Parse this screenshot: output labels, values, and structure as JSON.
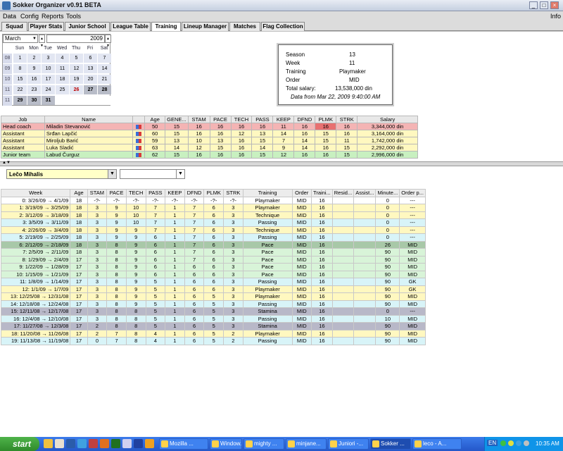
{
  "window": {
    "title": "Sokker Organizer v0.91 BETA",
    "min": "_",
    "max": "□",
    "close": "×"
  },
  "menu": {
    "items": [
      "Data",
      "Config",
      "Reports",
      "Tools"
    ],
    "info": "Info"
  },
  "tabs": [
    "Squad",
    "Player Stats",
    "Junior School",
    "League Table",
    "Training",
    "Lineup Manager",
    "Matches",
    "Flag Collection"
  ],
  "active_tab": "Training",
  "calendar": {
    "month": "March",
    "year": "2009",
    "dow": [
      "Sun",
      "Mon",
      "Tue",
      "Wed",
      "Thu",
      "Fri",
      "Sat"
    ],
    "weeks": [
      {
        "wk": "08",
        "days": [
          "1",
          "2",
          "3",
          "4",
          "5",
          "6",
          "7"
        ]
      },
      {
        "wk": "09",
        "days": [
          "8",
          "9",
          "10",
          "11",
          "12",
          "13",
          "14"
        ]
      },
      {
        "wk": "10",
        "days": [
          "15",
          "16",
          "17",
          "18",
          "19",
          "20",
          "21"
        ]
      },
      {
        "wk": "11",
        "days": [
          "22",
          "23",
          "24",
          "25",
          "26",
          "27",
          "28"
        ]
      },
      {
        "wk": "11",
        "days": [
          "29",
          "30",
          "31",
          "",
          "",
          "",
          ""
        ]
      }
    ],
    "selected": "26"
  },
  "info": {
    "rows": [
      {
        "label": "Season",
        "value": "13"
      },
      {
        "label": "Week",
        "value": "11"
      },
      {
        "label": "Training",
        "value": "Playmaker"
      },
      {
        "label": "Order",
        "value": "MID"
      },
      {
        "label": "Total salary:",
        "value": "13,538,000 din"
      }
    ],
    "data_from": "Data from Mar 22, 2009 9:40:00 AM"
  },
  "staff": {
    "headers": [
      "Job",
      "Name",
      "",
      "Age",
      "GENE...",
      "STAM",
      "PACE",
      "TECH",
      "PASS",
      "KEEP",
      "DFND",
      "PLMK",
      "STRK",
      "Salary"
    ],
    "rows": [
      {
        "job": "Head coach",
        "name": "Miladin Stevanović",
        "age": "50",
        "gene": "15",
        "stam": "16",
        "pace": "16",
        "tech": "16",
        "pass": "16",
        "keep": "11",
        "dfnd": "16",
        "plmk": "16",
        "strk": "16",
        "salary": "3,344,000 din",
        "color": "#f4b4b4"
      },
      {
        "job": "Assistant",
        "name": "Srđan Lapčić",
        "age": "60",
        "gene": "15",
        "stam": "16",
        "pace": "16",
        "tech": "12",
        "pass": "13",
        "keep": "14",
        "dfnd": "16",
        "plmk": "15",
        "strk": "16",
        "salary": "3,164,000 din",
        "color": "#fff8c0"
      },
      {
        "job": "Assistant",
        "name": "Miroljub Barić",
        "age": "59",
        "gene": "13",
        "stam": "10",
        "tech": "16",
        "pace": "13",
        "pass": "15",
        "keep": "7",
        "dfnd": "14",
        "plmk": "15",
        "strk": "11",
        "salary": "1,742,000 din",
        "color": "#fff8c0"
      },
      {
        "job": "Assistant",
        "name": "Luka Sladić",
        "age": "63",
        "gene": "14",
        "stam": "12",
        "pace": "15",
        "tech": "16",
        "pass": "14",
        "keep": "9",
        "dfnd": "14",
        "plmk": "16",
        "strk": "15",
        "salary": "2,292,000 din",
        "color": "#fff8c0"
      },
      {
        "job": "Junior team",
        "name": "Labud Čurguz",
        "age": "62",
        "gene": "15",
        "stam": "16",
        "pace": "16",
        "tech": "16",
        "pass": "15",
        "keep": "12",
        "dfnd": "16",
        "plmk": "16",
        "strk": "15",
        "salary": "2,996,000 din",
        "color": "#c8f0c0"
      }
    ]
  },
  "player_select": {
    "value": "Lečo Mihalis",
    "second": ""
  },
  "training": {
    "headers": [
      "Week",
      "Age",
      "STAM",
      "PACE",
      "TECH",
      "PASS",
      "KEEP",
      "DFND",
      "PLMK",
      "STRK",
      "Training",
      "Order",
      "Traini...",
      "Resid...",
      "Assist...",
      "Minute...",
      "Order p..."
    ],
    "rows": [
      {
        "week": "0: 3/26/09 → 4/1/09",
        "age": "18",
        "stam": "-?-",
        "pace": "-?-",
        "tech": "-?-",
        "pass": "-?-",
        "keep": "-?-",
        "dfnd": "-?-",
        "plmk": "-?-",
        "strk": "-?-",
        "training": "Playmaker",
        "order": "MID",
        "traini": "16",
        "resid": "",
        "assist": "",
        "minute": "0",
        "orderp": "---",
        "color": "#ffffff"
      },
      {
        "week": "1: 3/19/09 → 3/25/09",
        "age": "18",
        "stam": "3",
        "pace": "9",
        "tech": "10",
        "pass": "7",
        "keep": "1",
        "dfnd": "7",
        "plmk": "6",
        "strk": "3",
        "training": "Playmaker",
        "order": "MID",
        "traini": "16",
        "resid": "",
        "assist": "",
        "minute": "0",
        "orderp": "---",
        "color": "#fff8c0"
      },
      {
        "week": "2: 3/12/09 → 3/18/09",
        "age": "18",
        "stam": "3",
        "pace": "9",
        "tech": "10",
        "pass": "7",
        "keep": "1",
        "dfnd": "7",
        "plmk": "6",
        "strk": "3",
        "training": "Technique",
        "order": "MID",
        "traini": "16",
        "resid": "",
        "assist": "",
        "minute": "0",
        "orderp": "---",
        "color": "#fff8c0"
      },
      {
        "week": "3: 3/5/09 → 3/11/09",
        "age": "18",
        "stam": "3",
        "pace": "9",
        "tech": "10",
        "pass": "7",
        "keep": "1",
        "dfnd": "7",
        "plmk": "6",
        "strk": "3",
        "training": "Passing",
        "order": "MID",
        "traini": "16",
        "resid": "",
        "assist": "",
        "minute": "0",
        "orderp": "---",
        "color": "#d8f4f8"
      },
      {
        "week": "4: 2/26/09 → 3/4/09",
        "age": "18",
        "stam": "3",
        "pace": "9",
        "tech": "9",
        "pass": "7",
        "keep": "1",
        "dfnd": "7",
        "plmk": "6",
        "strk": "3",
        "training": "Technique",
        "order": "MID",
        "traini": "16",
        "resid": "",
        "assist": "",
        "minute": "0",
        "orderp": "---",
        "color": "#fff8c0"
      },
      {
        "week": "5: 2/19/09 → 2/25/09",
        "age": "18",
        "stam": "3",
        "pace": "9",
        "tech": "9",
        "pass": "6",
        "keep": "1",
        "dfnd": "7",
        "plmk": "6",
        "strk": "3",
        "training": "Passing",
        "order": "MID",
        "traini": "16",
        "resid": "",
        "assist": "",
        "minute": "0",
        "orderp": "---",
        "color": "#d8f4f8"
      },
      {
        "week": "6: 2/12/09 → 2/18/09",
        "age": "18",
        "stam": "3",
        "pace": "8",
        "tech": "9",
        "pass": "6",
        "keep": "1",
        "dfnd": "7",
        "plmk": "6",
        "strk": "3",
        "training": "Pace",
        "order": "MID",
        "traini": "16",
        "resid": "",
        "assist": "",
        "minute": "26",
        "orderp": "MID",
        "color": "#a8c8a8"
      },
      {
        "week": "7: 2/5/09 → 2/11/09",
        "age": "18",
        "stam": "3",
        "pace": "8",
        "tech": "9",
        "pass": "6",
        "keep": "1",
        "dfnd": "7",
        "plmk": "6",
        "strk": "3",
        "training": "Pace",
        "order": "MID",
        "traini": "16",
        "resid": "",
        "assist": "",
        "minute": "90",
        "orderp": "MID",
        "color": "#d8f4d8"
      },
      {
        "week": "8: 1/29/09 → 2/4/09",
        "age": "17",
        "stam": "3",
        "pace": "8",
        "tech": "9",
        "pass": "6",
        "keep": "1",
        "dfnd": "7",
        "plmk": "6",
        "strk": "3",
        "training": "Pace",
        "order": "MID",
        "traini": "16",
        "resid": "",
        "assist": "",
        "minute": "90",
        "orderp": "MID",
        "color": "#d8f4d8"
      },
      {
        "week": "9: 1/22/09 → 1/28/09",
        "age": "17",
        "stam": "3",
        "pace": "8",
        "tech": "9",
        "pass": "6",
        "keep": "1",
        "dfnd": "6",
        "plmk": "6",
        "strk": "3",
        "training": "Pace",
        "order": "MID",
        "traini": "16",
        "resid": "",
        "assist": "",
        "minute": "90",
        "orderp": "MID",
        "color": "#d8f4d8"
      },
      {
        "week": "10: 1/15/09 → 1/21/09",
        "age": "17",
        "stam": "3",
        "pace": "8",
        "tech": "9",
        "pass": "6",
        "keep": "1",
        "dfnd": "6",
        "plmk": "6",
        "strk": "3",
        "training": "Pace",
        "order": "MID",
        "traini": "16",
        "resid": "",
        "assist": "",
        "minute": "90",
        "orderp": "MID",
        "color": "#d8f4d8"
      },
      {
        "week": "11: 1/8/09 → 1/14/09",
        "age": "17",
        "stam": "3",
        "pace": "8",
        "tech": "9",
        "pass": "5",
        "keep": "1",
        "dfnd": "6",
        "plmk": "6",
        "strk": "3",
        "training": "Passing",
        "order": "MID",
        "traini": "16",
        "resid": "",
        "assist": "",
        "minute": "90",
        "orderp": "GK",
        "color": "#d8f4f8"
      },
      {
        "week": "12: 1/1/09 → 1/7/09",
        "age": "17",
        "stam": "3",
        "pace": "8",
        "tech": "9",
        "pass": "5",
        "keep": "1",
        "dfnd": "6",
        "plmk": "6",
        "strk": "3",
        "training": "Playmaker",
        "order": "MID",
        "traini": "16",
        "resid": "",
        "assist": "",
        "minute": "90",
        "orderp": "GK",
        "color": "#fff8c0"
      },
      {
        "week": "13: 12/25/08 → 12/31/08",
        "age": "17",
        "stam": "3",
        "pace": "8",
        "tech": "9",
        "pass": "5",
        "keep": "1",
        "dfnd": "6",
        "plmk": "5",
        "strk": "3",
        "training": "Playmaker",
        "order": "MID",
        "traini": "16",
        "resid": "",
        "assist": "",
        "minute": "90",
        "orderp": "MID",
        "color": "#fff8c0"
      },
      {
        "week": "14: 12/18/08 → 12/24/08",
        "age": "17",
        "stam": "3",
        "pace": "8",
        "tech": "9",
        "pass": "5",
        "keep": "1",
        "dfnd": "6",
        "plmk": "5",
        "strk": "3",
        "training": "Passing",
        "order": "MID",
        "traini": "16",
        "resid": "",
        "assist": "",
        "minute": "90",
        "orderp": "MID",
        "color": "#d8f4f8"
      },
      {
        "week": "15: 12/11/08 → 12/17/08",
        "age": "17",
        "stam": "3",
        "pace": "8",
        "tech": "8",
        "pass": "5",
        "keep": "1",
        "dfnd": "6",
        "plmk": "5",
        "strk": "3",
        "training": "Stamina",
        "order": "MID",
        "traini": "16",
        "resid": "",
        "assist": "",
        "minute": "0",
        "orderp": "---",
        "color": "#b8b8c8"
      },
      {
        "week": "16: 12/4/08 → 12/10/08",
        "age": "17",
        "stam": "3",
        "pace": "8",
        "tech": "8",
        "pass": "5",
        "keep": "1",
        "dfnd": "6",
        "plmk": "5",
        "strk": "3",
        "training": "Passing",
        "order": "MID",
        "traini": "16",
        "resid": "",
        "assist": "",
        "minute": "10",
        "orderp": "MID",
        "color": "#d8f4f8"
      },
      {
        "week": "17: 11/27/08 → 12/3/08",
        "age": "17",
        "stam": "2",
        "pace": "8",
        "tech": "8",
        "pass": "5",
        "keep": "1",
        "dfnd": "6",
        "plmk": "5",
        "strk": "3",
        "training": "Stamina",
        "order": "MID",
        "traini": "16",
        "resid": "",
        "assist": "",
        "minute": "90",
        "orderp": "MID",
        "color": "#b8b8c8"
      },
      {
        "week": "18: 11/20/08 → 11/26/08",
        "age": "17",
        "stam": "2",
        "pace": "7",
        "tech": "8",
        "pass": "4",
        "keep": "1",
        "dfnd": "6",
        "plmk": "5",
        "strk": "2",
        "training": "Playmaker",
        "order": "MID",
        "traini": "16",
        "resid": "",
        "assist": "",
        "minute": "90",
        "orderp": "MID",
        "color": "#fff8c0"
      },
      {
        "week": "19: 11/13/08 → 11/19/08",
        "age": "17",
        "stam": "0",
        "pace": "7",
        "tech": "8",
        "pass": "4",
        "keep": "1",
        "dfnd": "6",
        "plmk": "5",
        "strk": "2",
        "training": "Passing",
        "order": "MID",
        "traini": "16",
        "resid": "",
        "assist": "",
        "minute": "90",
        "orderp": "MID",
        "color": "#d8f4f8"
      }
    ]
  },
  "taskbar": {
    "start": "start",
    "items": [
      "Mozilla ...",
      "Window...",
      "mighty ...",
      "minjane...",
      "Juniori -...",
      "Sokker ...",
      "leco - A..."
    ],
    "active": "Sokker ...",
    "lang": "EN",
    "clock": "10:35 AM"
  }
}
